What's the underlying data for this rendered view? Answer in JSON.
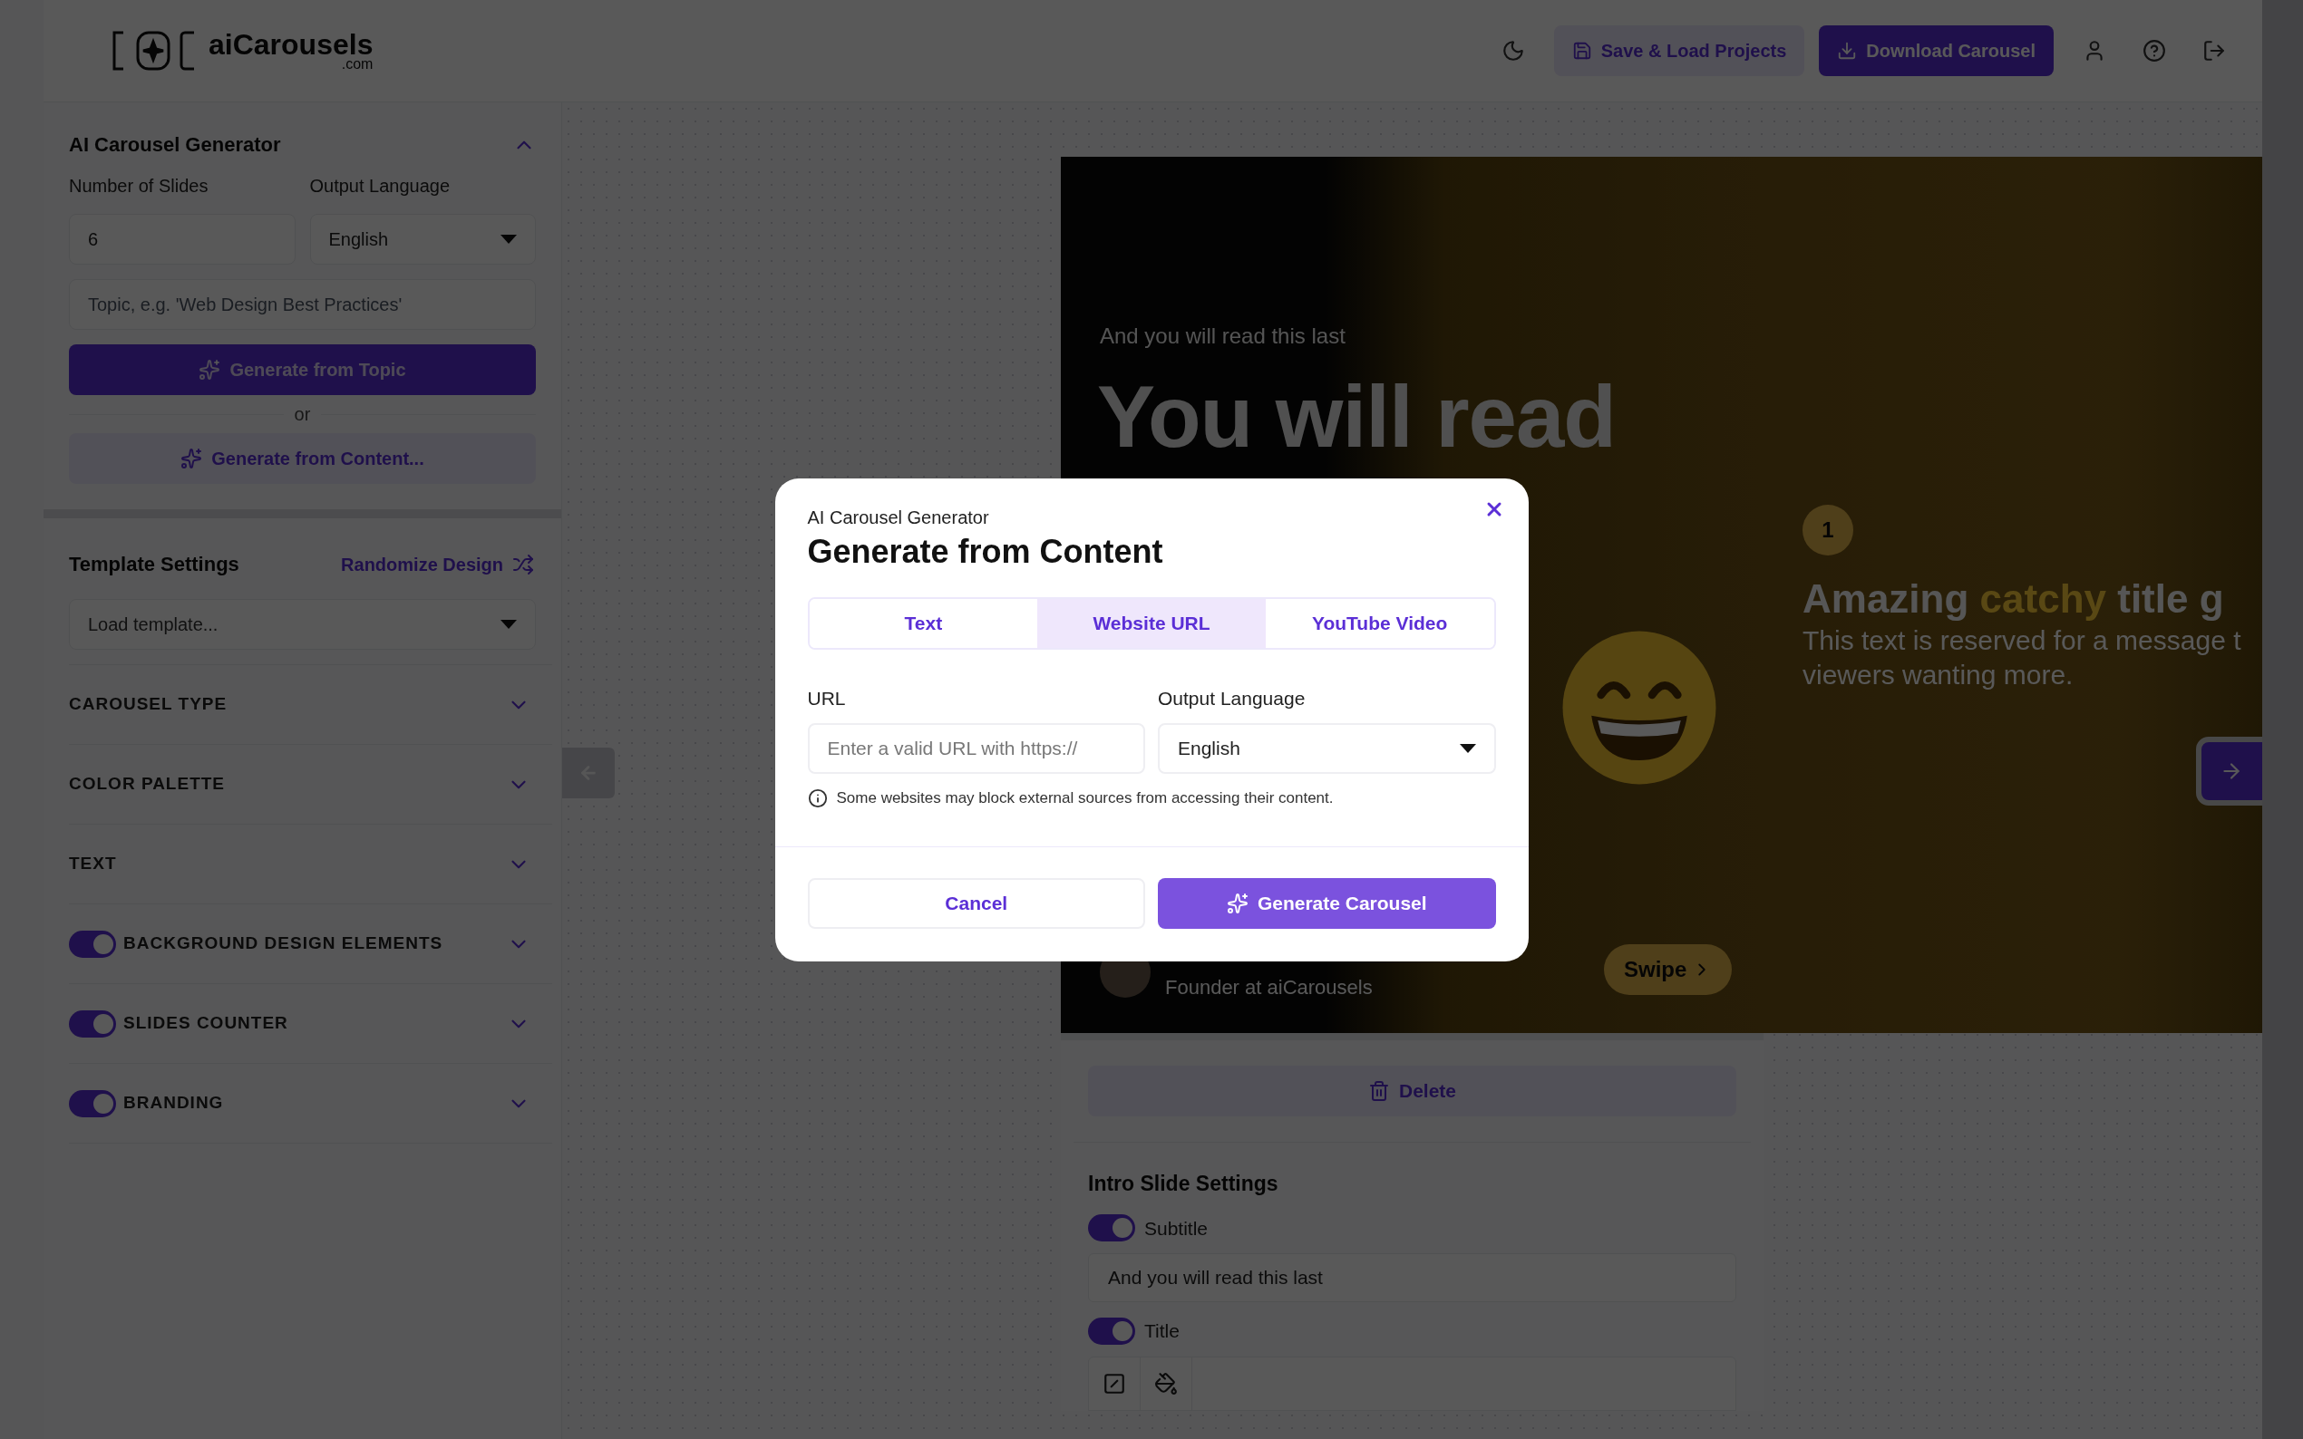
{
  "header": {
    "logo": {
      "name": "aiCarousels",
      "suffix": ".com"
    },
    "buttons": [
      {
        "label": "Save & Load Projects",
        "kind": "secondary"
      },
      {
        "label": "Download Carousel",
        "kind": "primary"
      }
    ]
  },
  "sidebar": {
    "generator": {
      "title": "AI Carousel Generator",
      "expanded": true,
      "slides_label": "Number of Slides",
      "slides_value": "6",
      "language_label": "Output Language",
      "language_value": "English",
      "topic_placeholder": "Topic, e.g. 'Web Design Best Practices'",
      "topic_button": "Generate from Topic",
      "or": "or",
      "content_button": "Generate from Content..."
    },
    "template": {
      "title": "Template Settings",
      "randomize": "Randomize Design",
      "load_placeholder": "Load template...",
      "sections": [
        {
          "label": "CAROUSEL TYPE",
          "expanded": false
        },
        {
          "label": "COLOR PALETTE",
          "expanded": false
        },
        {
          "label": "TEXT",
          "expanded": false
        }
      ],
      "toggle_sections": [
        {
          "label": "BACKGROUND DESIGN ELEMENTS",
          "on": true,
          "expanded": false
        },
        {
          "label": "SLIDES COUNTER",
          "on": true,
          "expanded": false
        },
        {
          "label": "BRANDING",
          "on": true,
          "expanded": false
        }
      ]
    }
  },
  "slide": {
    "subtitle": "And you will read this last",
    "title": "You will read",
    "counter": "1",
    "heading": [
      {
        "text": "Amazing ",
        "highlight": false
      },
      {
        "text": "catchy",
        "highlight": true
      },
      {
        "text": " title g",
        "highlight": false
      }
    ],
    "body_lines": [
      "This text is reserved for a message t",
      "viewers wanting more."
    ],
    "author_role": "Founder at aiCarousels",
    "swipe": "Swipe"
  },
  "editor": {
    "delete": "Delete",
    "title": "Intro Slide Settings",
    "fields": [
      {
        "label": "Subtitle",
        "on": true,
        "kind": "input",
        "value": "And you will read this last"
      },
      {
        "label": "Title",
        "on": true,
        "kind": "rich"
      }
    ]
  },
  "modal": {
    "kicker": "AI Carousel Generator",
    "title": "Generate from Content",
    "tabs": [
      {
        "label": "Text",
        "selected": false
      },
      {
        "label": "Website URL",
        "selected": true
      },
      {
        "label": "YouTube Video",
        "selected": false
      }
    ],
    "url_label": "URL",
    "url_placeholder": "Enter a valid URL with https://",
    "language_label": "Output Language",
    "language_value": "English",
    "note": "Some websites may block external sources from accessing their content.",
    "cancel": "Cancel",
    "submit": "Generate Carousel"
  }
}
